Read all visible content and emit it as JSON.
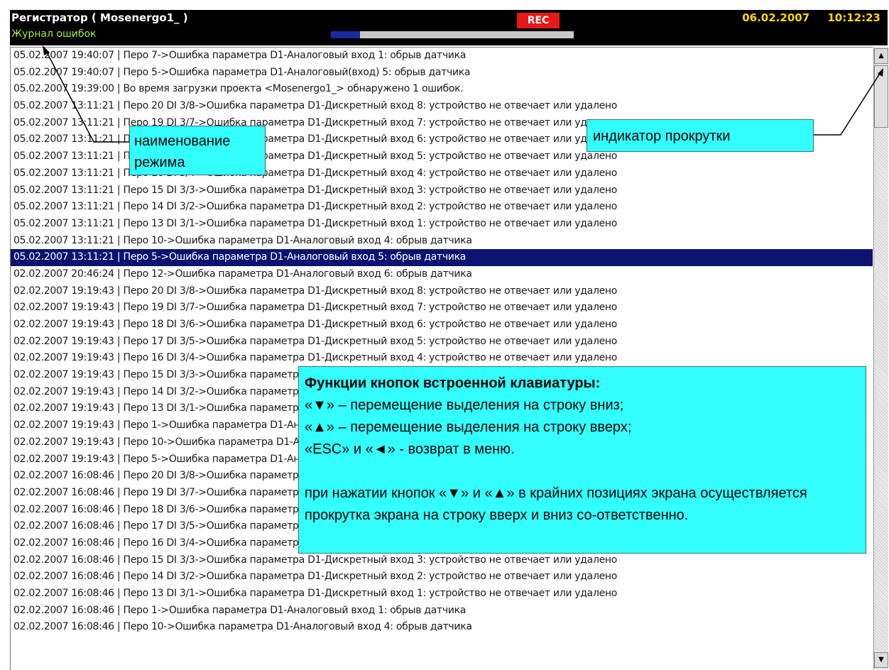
{
  "header": {
    "title": "Регистратор ( Mosenergo1_ )",
    "mode": "Журнал ошибок",
    "rec": "REC",
    "date": "06.02.2007",
    "time": "10:12:23",
    "progress": 0.12,
    "colors": {
      "bar": "#000000",
      "title": "#ffffff",
      "mode": "#a5ef3c",
      "rec_bg": "#e81818",
      "datetime": "#ffd700",
      "progress_fill": "#1a2a9c"
    }
  },
  "log": {
    "selected_index": 12,
    "rows": [
      "05.02.2007  19:40:07 | Перо 7->Ошибка параметра D1-Аналоговый вход 1: обрыв датчика",
      "05.02.2007  19:40:07 | Перо 5->Ошибка параметра D1-Аналоговый(вход) 5: обрыв датчика",
      "05.02.2007  19:39:00 | Во время загрузки проекта <Mosenergo1_> обнаружено 1 ошибок.",
      "05.02.2007  13:11:21 | Перо 20 DI 3/8->Ошибка параметра D1-Дискретный вход 8: устройство не отвечает или удалено",
      "05.02.2007  13:11:21 | Перо 19 DI 3/7->Ошибка параметра D1-Дискретный вход 7: устройство не отвечает или удалено",
      "05.02.2007  13:11:21 | Перо 18 DI 3/6->Ошибка параметра D1-Дискретный вход 6: устройство не отвечает или удалено",
      "05.02.2007  13:11:21 | Перо 17 DI 3/5->Ошибка параметра D1-Дискретный вход 5: устройство не отвечает или удалено",
      "05.02.2007  13:11:21 | Перо 16 DI 3/4->Ошибка параметра D1-Дискретный вход 4: устройство не отвечает или удалено",
      "05.02.2007  13:11:21 | Перо 15 DI 3/3->Ошибка параметра D1-Дискретный вход 3: устройство не отвечает или удалено",
      "05.02.2007  13:11:21 | Перо 14 DI 3/2->Ошибка параметра D1-Дискретный вход 2: устройство не отвечает или удалено",
      "05.02.2007  13:11:21 | Перо 13 DI 3/1->Ошибка параметра D1-Дискретный вход 1: устройство не отвечает или удалено",
      "05.02.2007  13:11:21 | Перо 10->Ошибка параметра D1-Аналоговый вход 4: обрыв датчика",
      "05.02.2007  13:11:21 | Перо 5->Ошибка параметра D1-Аналоговый вход 5: обрыв датчика",
      "02.02.2007  20:46:24 | Перо 12->Ошибка параметра D1-Аналоговый вход 6: обрыв датчика",
      "02.02.2007  19:19:43 | Перо 20 DI 3/8->Ошибка параметра D1-Дискретный вход 8: устройство не отвечает или удалено",
      "02.02.2007  19:19:43 | Перо 19 DI 3/7->Ошибка параметра D1-Дискретный вход 7: устройство не отвечает или удалено",
      "02.02.2007  19:19:43 | Перо 18 DI 3/6->Ошибка параметра D1-Дискретный вход 6: устройство не отвечает или удалено",
      "02.02.2007  19:19:43 | Перо 17 DI 3/5->Ошибка параметра D1-Дискретный вход 5: устройство не отвечает или удалено",
      "02.02.2007  19:19:43 | Перо 16 DI 3/4->Ошибка параметра D1-Дискретный вход 4: устройство не отвечает или удалено",
      "02.02.2007  19:19:43 | Перо 15 DI 3/3->Ошибка параметра D1-Дискретный вход 3: устройство не отвечает или удалено",
      "02.02.2007  19:19:43 | Перо 14 DI 3/2->Ошибка параметра D1-Дискретный вход 2: устройство не отвечает или удалено",
      "02.02.2007  19:19:43 | Перо 13 DI 3/1->Ошибка параметра D1-Дискретный вход 1: устройство не отвечает или удалено",
      "02.02.2007  19:19:43 | Перо 1->Ошибка параметра D1-Аналоговый вход 1: обрыв датчика",
      "02.02.2007  19:19:43 | Перо 10->Ошибка параметра D1-Аналоговый вход 4: обрыв датчика",
      "02.02.2007  19:19:43 | Перо 5->Ошибка параметра D1-Аналоговый вход 5: обрыв датчика",
      "02.02.2007  16:08:46 | Перо 20 DI 3/8->Ошибка параметра D1-Дискретный вход 8: устройство не отвечает или удалено",
      "02.02.2007  16:08:46 | Перо 19 DI 3/7->Ошибка параметра D1-Дискретный вход 7: устройство не отвечает или удалено",
      "02.02.2007  16:08:46 | Перо 18 DI 3/6->Ошибка параметра D1-Дискретный вход 6: устройство не отвечает или удалено",
      "02.02.2007  16:08:46 | Перо 17 DI 3/5->Ошибка параметра D1-Дискретный вход 5: устройство не отвечает или удалено",
      "02.02.2007  16:08:46 | Перо 16 DI 3/4->Ошибка параметра D1-Дискретный вход 4: устройство не отвечает или удалено",
      "02.02.2007  16:08:46 | Перо 15 DI 3/3->Ошибка параметра D1-Дискретный вход 3: устройство не отвечает или удалено",
      "02.02.2007  16:08:46 | Перо 14 DI 3/2->Ошибка параметра D1-Дискретный вход 2: устройство не отвечает или удалено",
      "02.02.2007  16:08:46 | Перо 13 DI 3/1->Ошибка параметра D1-Дискретный вход 1: устройство не отвечает или удалено",
      "02.02.2007  16:08:46 | Перо 1->Ошибка параметра D1-Аналоговый вход 1: обрыв датчика",
      "02.02.2007  16:08:46 | Перо 10->Ошибка параметра D1-Аналоговый вход 4: обрыв датчика"
    ]
  },
  "scrollbar": {
    "up_icon": "scroll-up-arrow",
    "down_icon": "scroll-down-arrow",
    "up_glyph": "▲",
    "down_glyph": "▼"
  },
  "callouts": {
    "mode_name": "наименование режима",
    "scroll_indicator": "индикатор прокрутки",
    "keys_title": "Функции кнопок встроенной клавиатуры:",
    "keys_lines": [
      "«▼» – перемещение выделения на строку вниз;",
      "«▲» – перемещение выделения на строку вверх;",
      "«ESC» и «◄» - возврат в меню."
    ],
    "keys_note": "при нажатии кнопок «▼» и «▲» в крайних позициях экрана осуществляется прокрутка экрана на строку вверх и вниз со-ответственно.",
    "color": "#33ffff"
  }
}
